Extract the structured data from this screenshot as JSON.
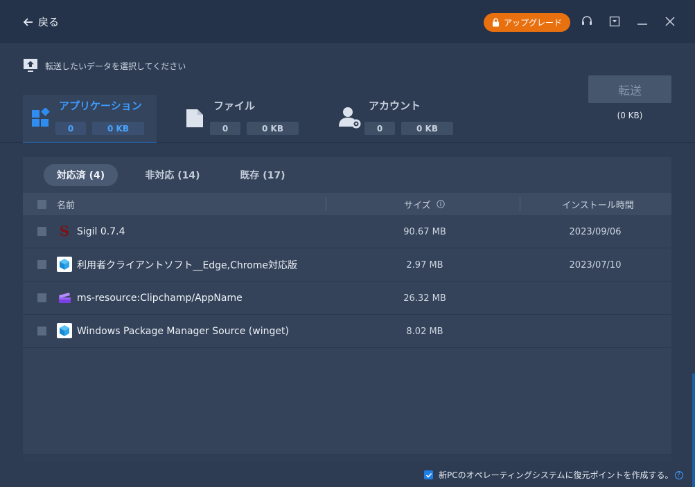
{
  "titlebar": {
    "back_label": "戻る",
    "upgrade_label": "アップグレード"
  },
  "hint": "転送したいデータを選択してください",
  "categories": [
    {
      "title": "アプリケーション",
      "count": "0",
      "size": "0 KB",
      "icon": "apps-icon"
    },
    {
      "title": "ファイル",
      "count": "0",
      "size": "0 KB",
      "icon": "file-icon"
    },
    {
      "title": "アカウント",
      "count": "0",
      "size": "0 KB",
      "icon": "account-icon"
    }
  ],
  "transfer": {
    "label": "転送",
    "size": "(0 KB)"
  },
  "subtabs": [
    {
      "label": "対応済 (4)"
    },
    {
      "label": "非対応 (14)"
    },
    {
      "label": "既存 (17)"
    }
  ],
  "table": {
    "headers": {
      "name": "名前",
      "size": "サイズ",
      "install_time": "インストール時間"
    },
    "rows": [
      {
        "name": "Sigil 0.7.4",
        "size": "90.67 MB",
        "date": "2023/09/06",
        "icon": "sigil-icon"
      },
      {
        "name": "利用者クライアントソフト__Edge,Chrome対応版",
        "size": "2.97 MB",
        "date": "2023/07/10",
        "icon": "package-icon"
      },
      {
        "name": "ms-resource:Clipchamp/AppName",
        "size": "26.32 MB",
        "date": "",
        "icon": "clipchamp-icon"
      },
      {
        "name": "Windows Package Manager Source (winget)",
        "size": "8.02 MB",
        "date": "",
        "icon": "package-icon"
      }
    ]
  },
  "footer": {
    "restore_point_label": "新PCのオペレーティングシステムに復元ポイントを作成する。",
    "restore_point_checked": true
  },
  "colors": {
    "accent": "#3d9bff",
    "upgrade": "#e8700f",
    "background": "#2d3c53"
  }
}
